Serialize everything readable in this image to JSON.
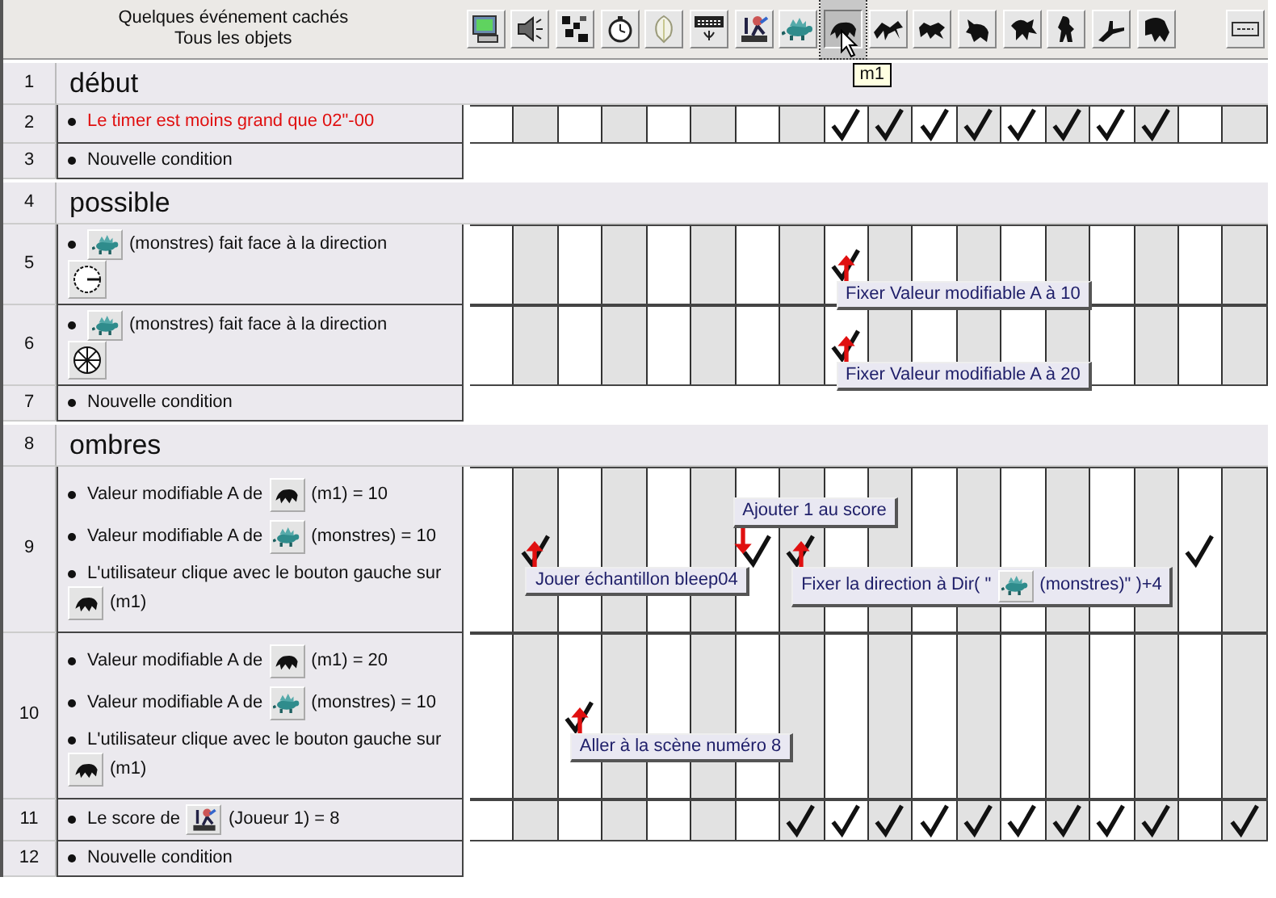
{
  "header": {
    "title_lines": [
      "Quelques événement cachés",
      "Tous les objets"
    ],
    "columns": [
      {
        "kind": "system",
        "selected": false
      },
      {
        "kind": "sound",
        "selected": false
      },
      {
        "kind": "storyboard",
        "selected": false
      },
      {
        "kind": "timer",
        "selected": false
      },
      {
        "kind": "create",
        "selected": false
      },
      {
        "kind": "keyboard",
        "selected": false
      },
      {
        "kind": "player",
        "selected": false
      },
      {
        "kind": "dino",
        "selected": false
      },
      {
        "kind": "creature",
        "selected": true,
        "tooltip": "m1"
      },
      {
        "kind": "creature",
        "selected": false
      },
      {
        "kind": "creature",
        "selected": false
      },
      {
        "kind": "creature",
        "selected": false
      },
      {
        "kind": "creature",
        "selected": false
      },
      {
        "kind": "creature",
        "selected": false
      },
      {
        "kind": "creature",
        "selected": false
      },
      {
        "kind": "creature",
        "selected": false
      },
      {
        "kind": "blank"
      },
      {
        "kind": "special",
        "selected": false
      }
    ]
  },
  "rows": [
    {
      "number": "1",
      "kind": "group",
      "title": "début"
    },
    {
      "number": "2",
      "kind": "event",
      "conditions": [
        {
          "highlighted": true,
          "parts": [
            {
              "kind": "text",
              "text": "Le timer est moins grand que 02\"-00"
            }
          ]
        }
      ],
      "cells": [
        {
          "checked": false
        },
        {
          "checked": false
        },
        {
          "checked": false
        },
        {
          "checked": false
        },
        {
          "checked": false
        },
        {
          "checked": false
        },
        {
          "checked": false
        },
        {
          "checked": false
        },
        {
          "checked": true
        },
        {
          "checked": true
        },
        {
          "checked": true
        },
        {
          "checked": true
        },
        {
          "checked": true
        },
        {
          "checked": true
        },
        {
          "checked": true
        },
        {
          "checked": true
        },
        {
          "checked": false
        },
        {
          "checked": false
        }
      ]
    },
    {
      "number": "3",
      "kind": "new",
      "conditions": [
        {
          "highlighted": false,
          "parts": [
            {
              "kind": "text",
              "text": "Nouvelle condition"
            }
          ]
        }
      ]
    },
    {
      "number": "4",
      "kind": "group",
      "title": "possible"
    },
    {
      "number": "5",
      "kind": "event",
      "conditions": [
        {
          "highlighted": false,
          "parts": [
            {
              "kind": "dino"
            },
            {
              "kind": "text",
              "text": "(monstres) fait face à la direction"
            },
            {
              "kind": "dial-single"
            }
          ]
        }
      ],
      "cells": [
        {
          "checked": false
        },
        {
          "checked": false
        },
        {
          "checked": false
        },
        {
          "checked": false
        },
        {
          "checked": false
        },
        {
          "checked": false
        },
        {
          "checked": false
        },
        {
          "checked": false
        },
        {
          "checked": true,
          "tooltip": {
            "above": false,
            "parts": [
              {
                "kind": "text",
                "text": "Fixer Valeur modifiable A à 10"
              }
            ]
          }
        },
        {
          "checked": false
        },
        {
          "checked": false
        },
        {
          "checked": false
        },
        {
          "checked": false
        },
        {
          "checked": false
        },
        {
          "checked": false
        },
        {
          "checked": false
        },
        {
          "checked": false
        },
        {
          "checked": false
        }
      ]
    },
    {
      "number": "6",
      "kind": "event",
      "conditions": [
        {
          "highlighted": false,
          "parts": [
            {
              "kind": "dino"
            },
            {
              "kind": "text",
              "text": "(monstres) fait face à la direction"
            },
            {
              "kind": "dial-all"
            }
          ]
        }
      ],
      "cells": [
        {
          "checked": false
        },
        {
          "checked": false
        },
        {
          "checked": false
        },
        {
          "checked": false
        },
        {
          "checked": false
        },
        {
          "checked": false
        },
        {
          "checked": false
        },
        {
          "checked": false
        },
        {
          "checked": true,
          "tooltip": {
            "above": false,
            "parts": [
              {
                "kind": "text",
                "text": "Fixer Valeur modifiable A à 20"
              }
            ]
          }
        },
        {
          "checked": false
        },
        {
          "checked": false
        },
        {
          "checked": false
        },
        {
          "checked": false
        },
        {
          "checked": false
        },
        {
          "checked": false
        },
        {
          "checked": false
        },
        {
          "checked": false
        },
        {
          "checked": false
        }
      ]
    },
    {
      "number": "7",
      "kind": "new",
      "conditions": [
        {
          "highlighted": false,
          "parts": [
            {
              "kind": "text",
              "text": "Nouvelle condition"
            }
          ]
        }
      ]
    },
    {
      "number": "8",
      "kind": "group",
      "title": "ombres"
    },
    {
      "number": "9",
      "kind": "event",
      "conditions": [
        {
          "highlighted": false,
          "parts": [
            {
              "kind": "text",
              "text": "Valeur modifiable A de"
            },
            {
              "kind": "creature"
            },
            {
              "kind": "text",
              "text": "(m1) = 10"
            }
          ]
        },
        {
          "highlighted": false,
          "parts": [
            {
              "kind": "text",
              "text": "Valeur modifiable A de"
            },
            {
              "kind": "dino"
            },
            {
              "kind": "text",
              "text": "(monstres) = 10"
            }
          ]
        },
        {
          "highlighted": false,
          "parts": [
            {
              "kind": "text",
              "text": "L'utilisateur clique avec le bouton gauche sur"
            },
            {
              "kind": "creature"
            },
            {
              "kind": "text",
              "text": "(m1)"
            }
          ]
        }
      ],
      "cells": [
        {
          "checked": false
        },
        {
          "checked": true,
          "tooltip": {
            "above": false,
            "parts": [
              {
                "kind": "text",
                "text": "Jouer échantillon bleep04"
              }
            ]
          }
        },
        {
          "checked": false
        },
        {
          "checked": false
        },
        {
          "checked": false
        },
        {
          "checked": false
        },
        {
          "checked": true,
          "tooltip": {
            "above": true,
            "parts": [
              {
                "kind": "text",
                "text": "Ajouter 1 au score"
              }
            ]
          }
        },
        {
          "checked": true,
          "tooltip": {
            "above": false,
            "parts": [
              {
                "kind": "text",
                "text": "Fixer la direction à Dir( \""
              },
              {
                "kind": "dino"
              },
              {
                "kind": "text",
                "text": "(monstres)\" )+4"
              }
            ]
          }
        },
        {
          "checked": false
        },
        {
          "checked": false
        },
        {
          "checked": false
        },
        {
          "checked": false
        },
        {
          "checked": false
        },
        {
          "checked": false
        },
        {
          "checked": false
        },
        {
          "checked": false
        },
        {
          "checked": true
        },
        {
          "checked": false
        }
      ]
    },
    {
      "number": "10",
      "kind": "event",
      "conditions": [
        {
          "highlighted": false,
          "parts": [
            {
              "kind": "text",
              "text": "Valeur modifiable A de"
            },
            {
              "kind": "creature"
            },
            {
              "kind": "text",
              "text": "(m1) = 20"
            }
          ]
        },
        {
          "highlighted": false,
          "parts": [
            {
              "kind": "text",
              "text": "Valeur modifiable A de"
            },
            {
              "kind": "dino"
            },
            {
              "kind": "text",
              "text": "(monstres) = 10"
            }
          ]
        },
        {
          "highlighted": false,
          "parts": [
            {
              "kind": "text",
              "text": "L'utilisateur clique avec le bouton gauche sur"
            },
            {
              "kind": "creature"
            },
            {
              "kind": "text",
              "text": "(m1)"
            }
          ]
        }
      ],
      "cells": [
        {
          "checked": false
        },
        {
          "checked": false
        },
        {
          "checked": true,
          "tooltip": {
            "above": false,
            "parts": [
              {
                "kind": "text",
                "text": "Aller à la scène numéro 8"
              }
            ]
          }
        },
        {
          "checked": false
        },
        {
          "checked": false
        },
        {
          "checked": false
        },
        {
          "checked": false
        },
        {
          "checked": false
        },
        {
          "checked": false
        },
        {
          "checked": false
        },
        {
          "checked": false
        },
        {
          "checked": false
        },
        {
          "checked": false
        },
        {
          "checked": false
        },
        {
          "checked": false
        },
        {
          "checked": false
        },
        {
          "checked": false
        },
        {
          "checked": false
        }
      ]
    },
    {
      "number": "11",
      "kind": "event",
      "conditions": [
        {
          "highlighted": false,
          "parts": [
            {
              "kind": "text",
              "text": "Le score de"
            },
            {
              "kind": "player"
            },
            {
              "kind": "text",
              "text": "(Joueur 1) = 8"
            }
          ]
        }
      ],
      "cells": [
        {
          "checked": false
        },
        {
          "checked": false
        },
        {
          "checked": false
        },
        {
          "checked": false
        },
        {
          "checked": false
        },
        {
          "checked": false
        },
        {
          "checked": false
        },
        {
          "checked": true
        },
        {
          "checked": true
        },
        {
          "checked": true
        },
        {
          "checked": true
        },
        {
          "checked": true
        },
        {
          "checked": true
        },
        {
          "checked": true
        },
        {
          "checked": true
        },
        {
          "checked": true
        },
        {
          "checked": false
        },
        {
          "checked": true
        }
      ]
    },
    {
      "number": "12",
      "kind": "new",
      "conditions": [
        {
          "highlighted": false,
          "parts": [
            {
              "kind": "text",
              "text": "Nouvelle condition"
            }
          ]
        }
      ]
    }
  ]
}
